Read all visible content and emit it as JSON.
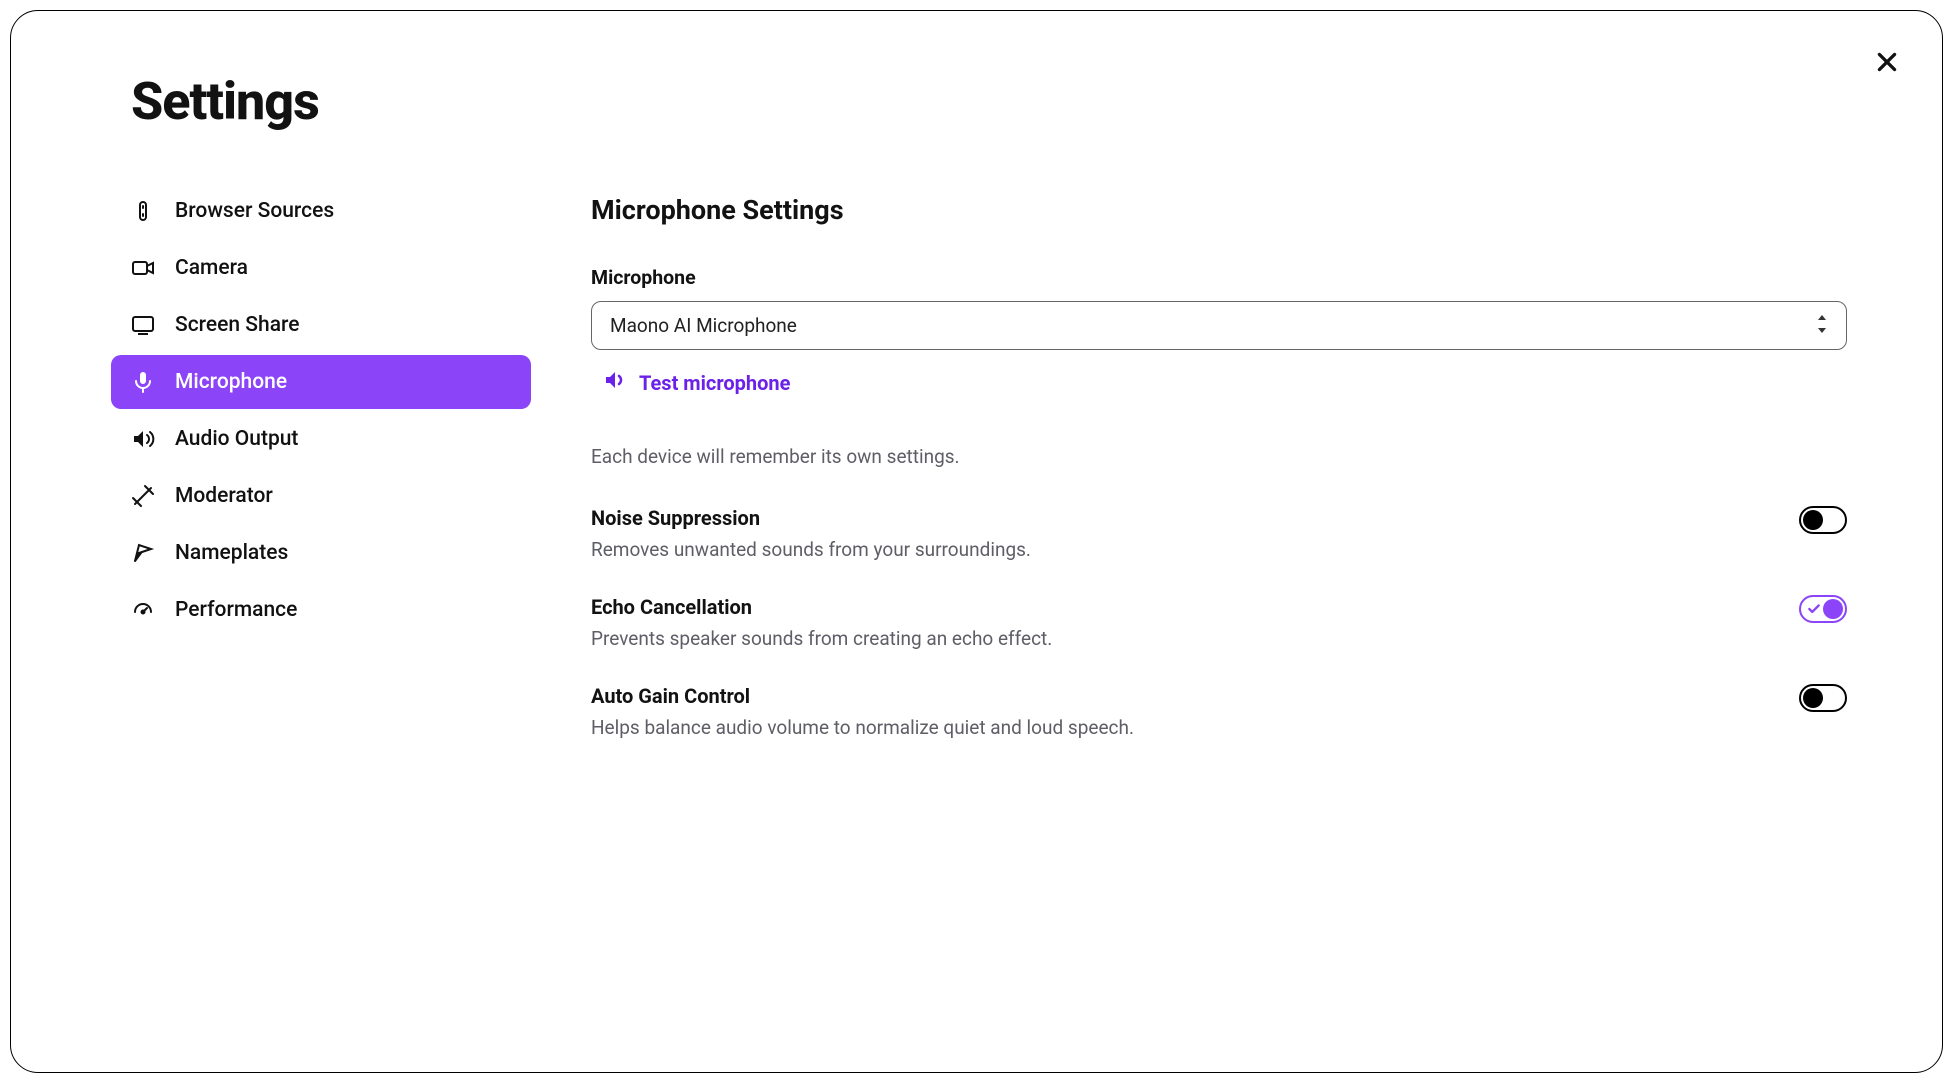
{
  "title": "Settings",
  "sidebar": {
    "items": [
      {
        "label": "Browser Sources",
        "icon": "browser-sources-icon",
        "active": false
      },
      {
        "label": "Camera",
        "icon": "camera-icon",
        "active": false
      },
      {
        "label": "Screen Share",
        "icon": "screen-share-icon",
        "active": false
      },
      {
        "label": "Microphone",
        "icon": "microphone-icon",
        "active": true
      },
      {
        "label": "Audio Output",
        "icon": "audio-output-icon",
        "active": false
      },
      {
        "label": "Moderator",
        "icon": "moderator-icon",
        "active": false
      },
      {
        "label": "Nameplates",
        "icon": "nameplates-icon",
        "active": false
      },
      {
        "label": "Performance",
        "icon": "performance-icon",
        "active": false
      }
    ]
  },
  "main": {
    "section_title": "Microphone Settings",
    "microphone": {
      "label": "Microphone",
      "selected": "Maono AI Microphone",
      "test_label": "Test microphone"
    },
    "hint": "Each device will remember its own settings.",
    "options": [
      {
        "title": "Noise Suppression",
        "desc": "Removes unwanted sounds from your surroundings.",
        "on": false
      },
      {
        "title": "Echo Cancellation",
        "desc": "Prevents speaker sounds from creating an echo effect.",
        "on": true
      },
      {
        "title": "Auto Gain Control",
        "desc": "Helps balance audio volume to normalize quiet and loud speech.",
        "on": false
      }
    ]
  },
  "colors": {
    "accent": "#8b44f7"
  }
}
